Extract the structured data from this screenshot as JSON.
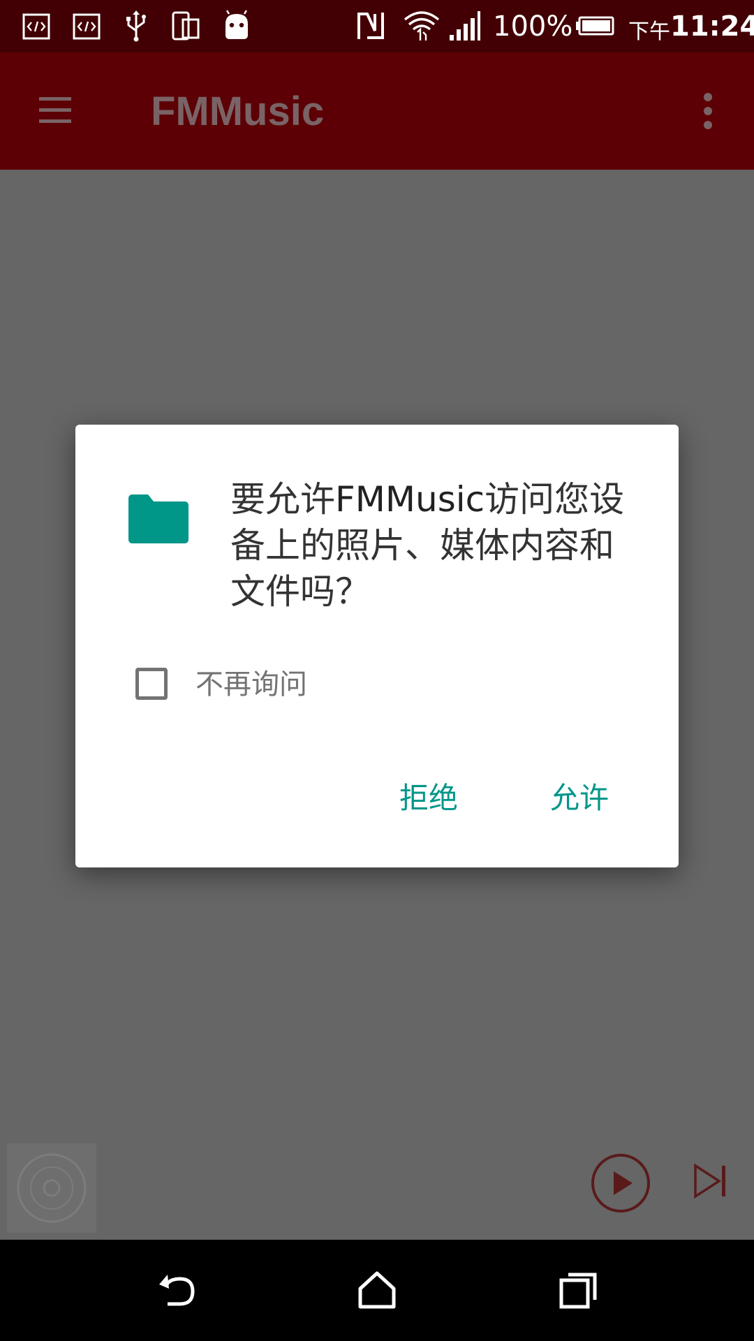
{
  "status_bar": {
    "battery_percent": "100%",
    "time_prefix": "下午",
    "time": "11:24",
    "icons": [
      "code-icon",
      "code-icon",
      "usb-icon",
      "device-icon",
      "android-icon",
      "nfc-icon",
      "wifi-icon",
      "signal-icon",
      "battery-icon"
    ]
  },
  "app_bar": {
    "title": "FMMusic",
    "menu_icon": "menu-icon",
    "overflow_icon": "more-vert-icon"
  },
  "dialog": {
    "icon": "folder-icon",
    "message_prefix": "要允许",
    "message_app": "FMMusic",
    "message_suffix": "访问您设备上的照片、媒体内容和文件吗？",
    "dont_ask_label": "不再询问",
    "dont_ask_checked": false,
    "deny_label": "拒绝",
    "allow_label": "允许"
  },
  "mini_player": {
    "album_icon": "disc-icon",
    "play_icon": "play-icon",
    "next_icon": "skip-next-icon"
  },
  "nav_bar": {
    "icons": [
      "back-icon",
      "home-icon",
      "recents-icon"
    ]
  },
  "colors": {
    "status_bar": "#420004",
    "app_bar": "#5c0005",
    "scrim_content": "#666666",
    "accent": "#009688",
    "player_accent": "#5a1a1a"
  }
}
